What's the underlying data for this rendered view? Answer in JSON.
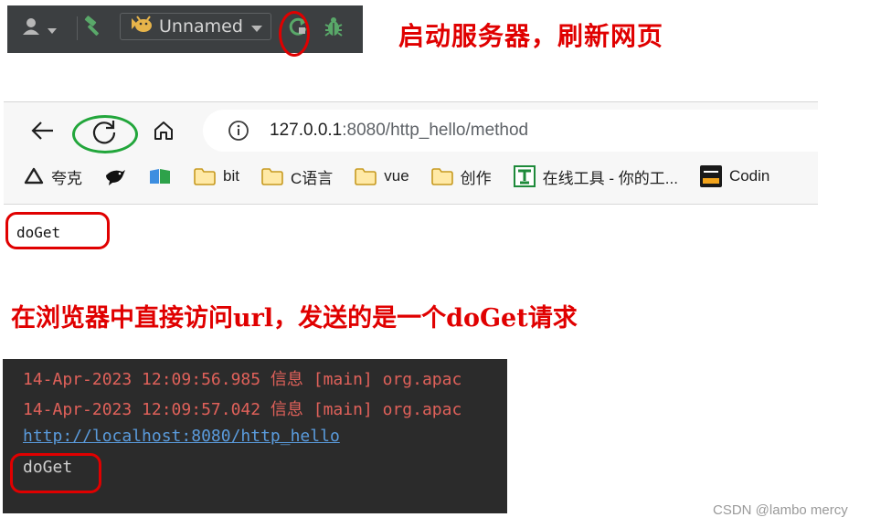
{
  "ide": {
    "run_config": "Unnamed",
    "icons": {
      "user": "user-icon",
      "build": "hammer-icon",
      "config": "tomcat-icon",
      "rerun": "rerun-icon",
      "debug": "bug-icon"
    }
  },
  "annotations": {
    "step1": "启动服务器，刷新网页",
    "step2": "在浏览器中直接访问url，发送的是一个doGet请求"
  },
  "browser": {
    "url_host": "127.0.0.1",
    "url_path": ":8080/http_hello/method",
    "bookmarks": [
      {
        "label": "夸克",
        "icon": "quark-icon"
      },
      {
        "label": "",
        "icon": "bird-icon"
      },
      {
        "label": "",
        "icon": "bookshelf-icon"
      },
      {
        "label": "bit",
        "icon": "folder-icon"
      },
      {
        "label": "C语言",
        "icon": "folder-icon"
      },
      {
        "label": "vue",
        "icon": "folder-icon"
      },
      {
        "label": "创作",
        "icon": "folder-icon"
      },
      {
        "label": "在线工具 - 你的工...",
        "icon": "tool-icon"
      },
      {
        "label": "Codin",
        "icon": "codingtree-icon"
      }
    ],
    "page_text": "doGet"
  },
  "console": {
    "lines": [
      "14-Apr-2023 12:09:56.985 信息 [main] org.apac",
      "14-Apr-2023 12:09:57.042 信息 [main] org.apac"
    ],
    "link": "http://localhost:8080/http_hello",
    "output": "doGet"
  },
  "watermark": "CSDN @lambo mercy",
  "colors": {
    "annotation": "#e00000",
    "reload_highlight": "#22a63b",
    "console_bg": "#2b2b2b",
    "log_red": "#e0615a",
    "link_blue": "#5a9bdc"
  }
}
